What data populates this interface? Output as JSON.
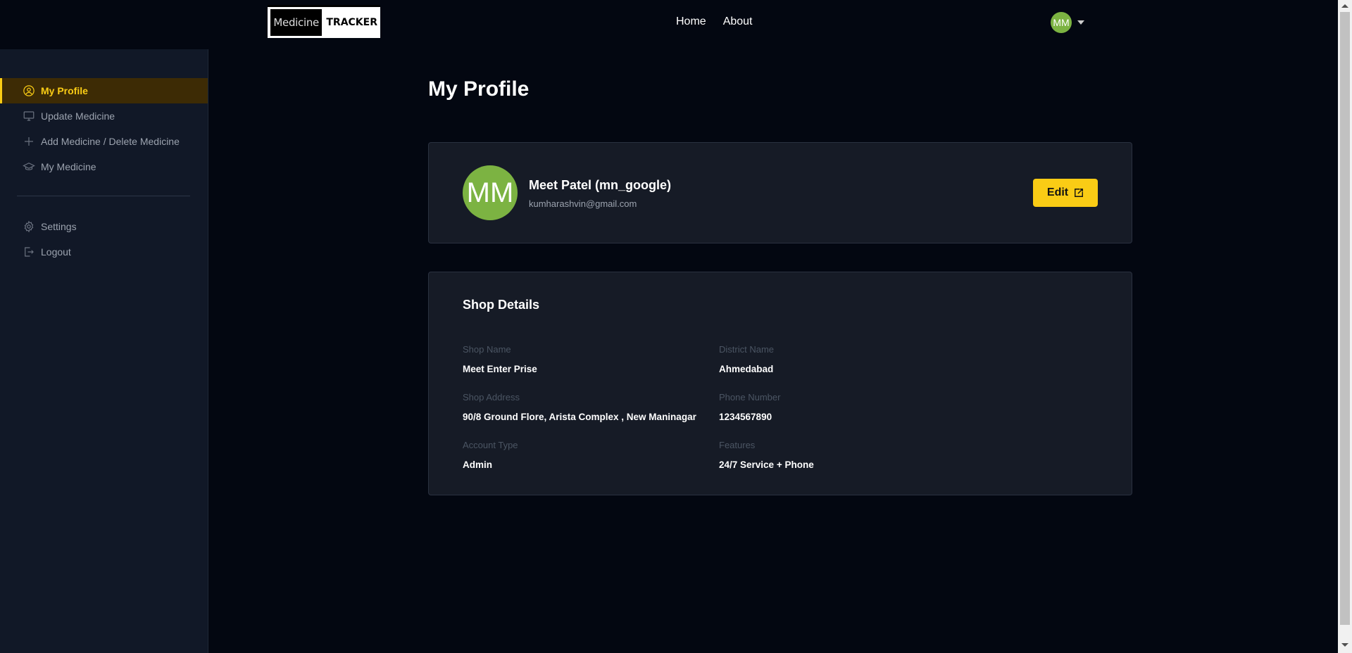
{
  "brand": {
    "left": "Medicine",
    "right": "TRACKER"
  },
  "nav": {
    "home": "Home",
    "about": "About"
  },
  "user": {
    "initials": "MM"
  },
  "sidebar": {
    "items": [
      {
        "label": "My Profile",
        "icon": "user-circle-icon",
        "active": true
      },
      {
        "label": "Update Medicine",
        "icon": "monitor-icon"
      },
      {
        "label": "Add Medicine / Delete Medicine",
        "icon": "plus-icon"
      },
      {
        "label": "My Medicine",
        "icon": "graduation-cap-icon"
      }
    ],
    "bottom": [
      {
        "label": "Settings",
        "icon": "gear-icon"
      },
      {
        "label": "Logout",
        "icon": "logout-icon"
      }
    ]
  },
  "page": {
    "title": "My Profile"
  },
  "profile": {
    "initials": "MM",
    "name": "Meet Patel (mn_google)",
    "email": "kumharashvin@gmail.com",
    "edit_label": "Edit"
  },
  "shop": {
    "title": "Shop Details",
    "fields": [
      {
        "label": "Shop Name",
        "value": "Meet Enter Prise"
      },
      {
        "label": "District Name",
        "value": "Ahmedabad"
      },
      {
        "label": "Shop Address",
        "value": "90/8 Ground Flore, Arista Complex , New Maninagar"
      },
      {
        "label": "Phone Number",
        "value": "1234567890"
      },
      {
        "label": "Account Type",
        "value": "Admin"
      },
      {
        "label": "Features",
        "value": "24/7 Service + Phone"
      }
    ]
  },
  "colors": {
    "accent": "#facc15",
    "avatar": "#7cb342",
    "background": "#030711",
    "sidebar": "#111827"
  }
}
